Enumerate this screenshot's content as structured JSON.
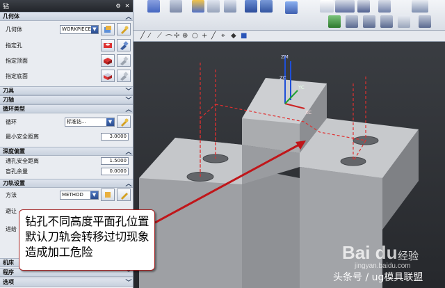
{
  "dialog": {
    "title": "钻",
    "sections": {
      "geometry": "几何体",
      "tool": "刀具",
      "tool_axis": "刀轴",
      "cycle_type": "循环类型",
      "depth_offset": "深度偏置",
      "path_settings": "刀轨设置",
      "machine": "机床",
      "program": "程序",
      "options": "选项"
    },
    "geometry": {
      "label": "几何体",
      "value": "WORKPIECE",
      "specify_hole": "指定孔",
      "specify_top": "指定顶面",
      "specify_bottom": "指定底面"
    },
    "cycle": {
      "label": "循环",
      "value": "标准钻...",
      "min_clearance_label": "最小安全距离",
      "min_clearance_value": "3.0000"
    },
    "depth": {
      "through_label": "通孔安全距离",
      "through_value": "1.5000",
      "blind_label": "盲孔余量",
      "blind_value": "0.0000"
    },
    "path": {
      "method_label": "方法",
      "method_value": "METHOD",
      "avoid_label": "避让",
      "feed_label": "进给"
    }
  },
  "viewport": {
    "axes": {
      "x": "XC",
      "y": "YC",
      "z": "ZC",
      "zm": "ZM"
    }
  },
  "annotation": {
    "lines": [
      "钻孔不同高度平面孔位置",
      "默认刀轨会转移过切现象",
      "造成加工危险"
    ]
  },
  "watermark": {
    "logo": "Bai du",
    "jingyan": "经验",
    "url": "jingyan.baidu.com",
    "credit": "头条号 / ug模具联盟"
  },
  "colors": {
    "background": "#2f3236",
    "solid_top": "#c5c7ca",
    "solid_side": "#8f9195",
    "solid_front": "#a9abae",
    "toolpath": "#e03030",
    "arrow": "#c0161a"
  }
}
